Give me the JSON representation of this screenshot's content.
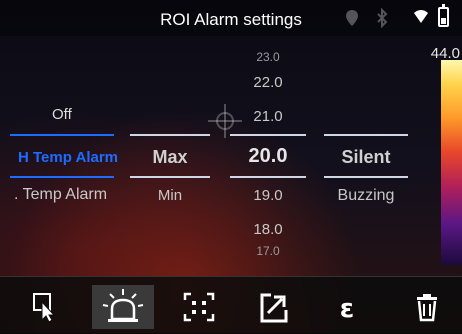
{
  "header": {
    "title": "ROI Alarm settings"
  },
  "scale": {
    "max": "44.0"
  },
  "left_column": {
    "items": [
      {
        "label": "Off"
      },
      {
        "label": "H Temp Alarm"
      },
      {
        "label": ". Temp Alarm"
      }
    ]
  },
  "mode_column": {
    "selected": "Max",
    "below": "Min"
  },
  "value_column": {
    "above": [
      "23.0",
      "22.0",
      "21.0"
    ],
    "selected": "20.0",
    "below": [
      "19.0",
      "18.0",
      "17.0"
    ]
  },
  "sound_column": {
    "selected": "Silent",
    "below": "Buzzing"
  },
  "toolbar": {
    "buttons": [
      {
        "icon": "select-cursor-icon"
      },
      {
        "icon": "alarm-light-icon",
        "active": true
      },
      {
        "icon": "expand-region-icon"
      },
      {
        "icon": "export-icon"
      },
      {
        "icon": "emissivity-icon"
      },
      {
        "icon": "trash-icon"
      }
    ]
  },
  "colors": {
    "accent": "#1e6bff",
    "highlight_line": "#cfd6e6",
    "background": "#050505"
  }
}
